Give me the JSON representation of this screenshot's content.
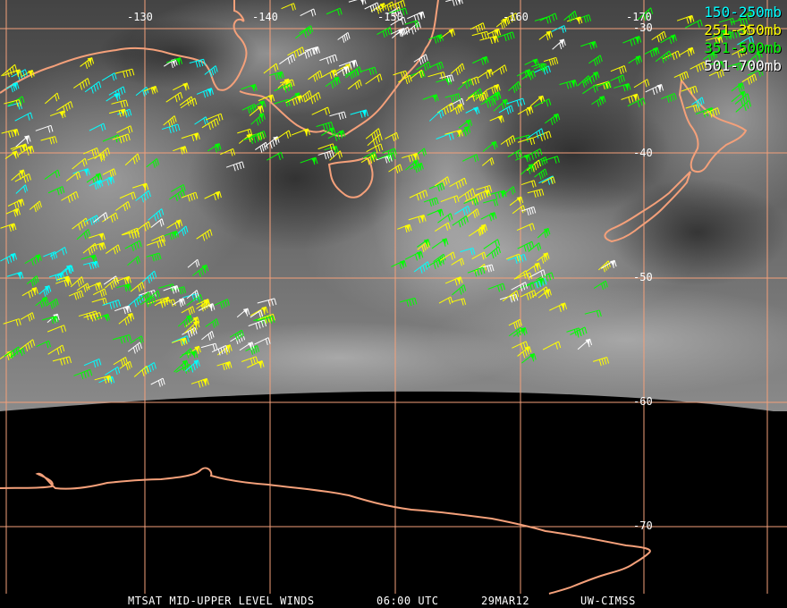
{
  "legend": [
    {
      "label": "150-250mb",
      "color": "#00ffff"
    },
    {
      "label": "251-350mb",
      "color": "#ffff00"
    },
    {
      "label": "351-500mb",
      "color": "#00ff00"
    },
    {
      "label": "501-700mb",
      "color": "#ffffff"
    }
  ],
  "footer": {
    "product": "MTSAT MID-UPPER LEVEL WINDS",
    "time": "06:00 UTC",
    "date": "29MAR12",
    "source": "UW-CIMSS"
  },
  "longitude_labels": [
    "-130",
    "-140",
    "-150",
    "-160",
    "-170"
  ],
  "latitude_labels": [
    "-30",
    "-40",
    "-50",
    "-60",
    "-70"
  ],
  "colors": {
    "grid": "#f4a07a",
    "coast": "#f4a07a",
    "night": "#000000",
    "cloud_dark": "#3a3a3a",
    "cloud_light": "#bdbdbd"
  }
}
